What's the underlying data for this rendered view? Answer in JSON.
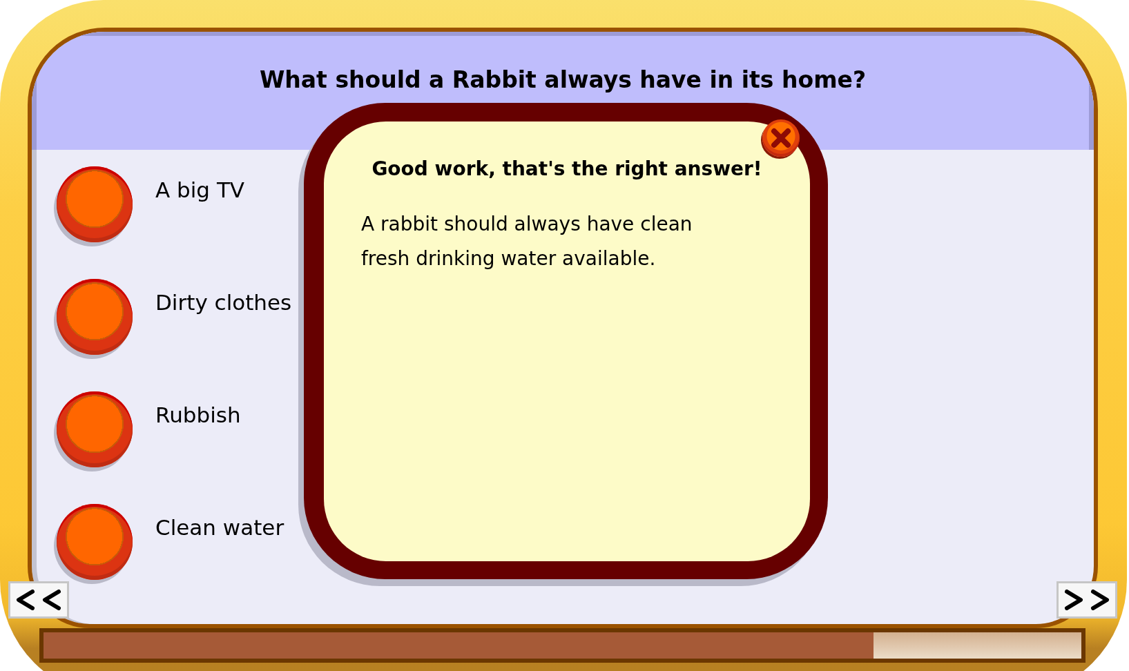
{
  "question": "What should a Rabbit always have in its home?",
  "answers": [
    {
      "label": "A big TV"
    },
    {
      "label": "Dirty clothes"
    },
    {
      "label": "Rubbish"
    },
    {
      "label": "Clean water"
    }
  ],
  "feedback": {
    "title": "Good work, that's the right answer!",
    "message": "A rabbit should always have clean fresh drinking water available."
  },
  "progress": {
    "level": 0.8
  }
}
